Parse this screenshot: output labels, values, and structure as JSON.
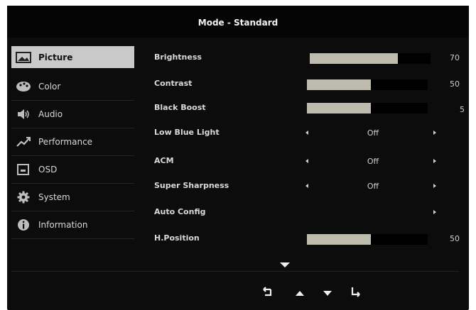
{
  "header": {
    "title": "Mode - Standard"
  },
  "sidebar": {
    "items": [
      {
        "label": "Picture",
        "icon": "picture-icon",
        "selected": true
      },
      {
        "label": "Color",
        "icon": "palette-icon"
      },
      {
        "label": "Audio",
        "icon": "speaker-icon"
      },
      {
        "label": "Performance",
        "icon": "performance-icon"
      },
      {
        "label": "OSD",
        "icon": "osd-icon"
      },
      {
        "label": "System",
        "icon": "gear-icon"
      },
      {
        "label": "Information",
        "icon": "info-icon"
      }
    ]
  },
  "settings": [
    {
      "label": "Brightness",
      "type": "slider",
      "value": "70",
      "level": 0.73
    },
    {
      "label": "Contrast",
      "type": "slider",
      "value": "50",
      "level": 0.53
    },
    {
      "label": "Black Boost",
      "type": "slider",
      "value": "5",
      "level": 0.53
    },
    {
      "label": "Low Blue Light",
      "type": "option",
      "value": "Off"
    },
    {
      "label": "ACM",
      "type": "option",
      "value": "Off"
    },
    {
      "label": "Super Sharpness",
      "type": "option",
      "value": "Off"
    },
    {
      "label": "Auto Config",
      "type": "action"
    },
    {
      "label": "H.Position",
      "type": "slider",
      "value": "50",
      "level": 0.53
    }
  ],
  "nav": {
    "more_indicator": "down-arrow-icon",
    "buttons": [
      "back-icon",
      "up-icon",
      "down-icon",
      "enter-icon"
    ]
  },
  "colors": {
    "background": "#0c0c0c",
    "highlight": "#c9c9c9",
    "bar_fill": "#bdbbae"
  }
}
